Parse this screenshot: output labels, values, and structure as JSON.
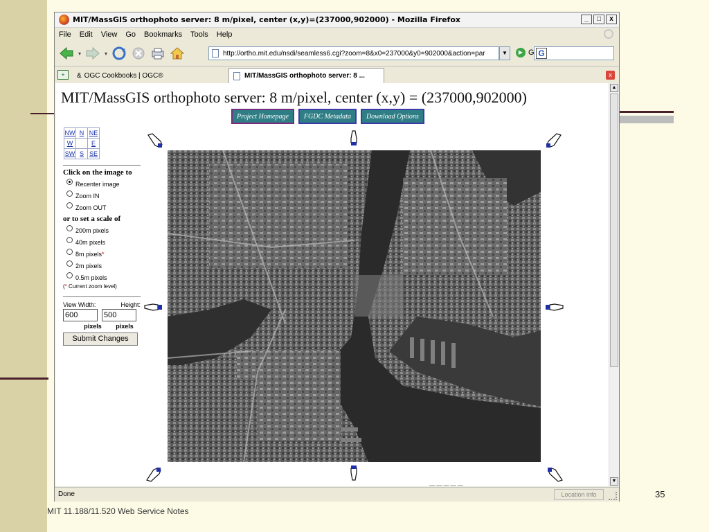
{
  "slide": {
    "number": "35",
    "footer": "MIT 11.188/11.520 Web Service Notes"
  },
  "window": {
    "title": "MIT/MassGIS orthophoto server: 8 m/pixel, center (x,y)=(237000,902000) - Mozilla Firefox",
    "controls": {
      "minimize": "_",
      "maximize": "□",
      "close": "x"
    }
  },
  "menu": {
    "items": [
      {
        "label": "File",
        "key": "F"
      },
      {
        "label": "Edit",
        "key": "E"
      },
      {
        "label": "View",
        "key": "V"
      },
      {
        "label": "Go",
        "key": "G"
      },
      {
        "label": "Bookmarks",
        "key": "B"
      },
      {
        "label": "Tools",
        "key": "T"
      },
      {
        "label": "Help",
        "key": "H"
      }
    ]
  },
  "toolbar": {
    "url": "http://ortho.mit.edu/nsdi/seamless6.cgi?zoom=8&x0=237000&y0=902000&action=par",
    "go_label": "Go",
    "search_logo": "G",
    "icons": [
      "back-icon",
      "forward-icon",
      "reload-icon",
      "stop-icon",
      "home-icon"
    ]
  },
  "tabs": [
    {
      "label": "OGC Cookbooks | OGC®"
    },
    {
      "label": "MIT/MassGIS orthophoto server: 8 ..."
    }
  ],
  "page": {
    "title": "MIT/MassGIS orthophoto server: 8 m/pixel, center (x,y) = (237000,902000)",
    "buttons": [
      "Project Homepage",
      "FGDC Metadata",
      "Download Options"
    ],
    "directions": {
      "nw": "NW",
      "n": "N",
      "ne": "NE",
      "w": "W",
      "e": "E",
      "sw": "SW",
      "s": "S",
      "se": "SE"
    },
    "click_heading": "Click on the image to",
    "click_options": [
      {
        "label": "Recenter image",
        "selected": true
      },
      {
        "label": "Zoom IN",
        "selected": false
      },
      {
        "label": "Zoom OUT",
        "selected": false
      }
    ],
    "scale_heading": "or to set a scale of",
    "scale_options": [
      {
        "label": "200m pixels",
        "selected": false,
        "current": false
      },
      {
        "label": "40m pixels",
        "selected": false,
        "current": false
      },
      {
        "label": "8m pixels",
        "selected": false,
        "current": true
      },
      {
        "label": "2m pixels",
        "selected": false,
        "current": false
      },
      {
        "label": "0.5m pixels",
        "selected": false,
        "current": false
      }
    ],
    "current_marker": "*",
    "zoom_note": "Current zoom level)",
    "zoom_note_prefix": "(",
    "view_width_label": "View Width:",
    "height_label": "Height:",
    "width_value": "600",
    "height_value": "500",
    "pixels_label": "pixels",
    "submit_label": "Submit Changes"
  },
  "status": {
    "text": "Done",
    "location_info": "Location info"
  }
}
